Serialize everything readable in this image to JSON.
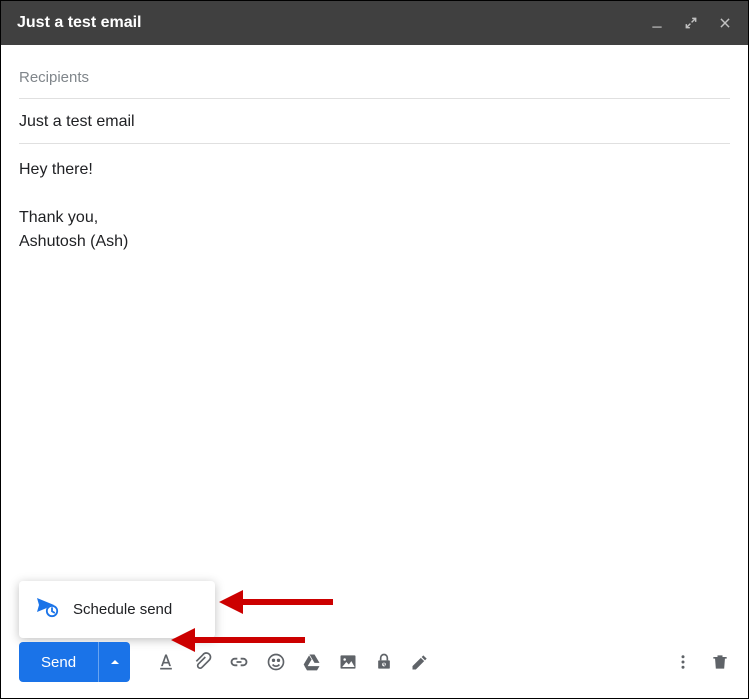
{
  "titlebar": {
    "title": "Just a test email"
  },
  "fields": {
    "recipients_placeholder": "Recipients",
    "subject": "Just a test email"
  },
  "body": {
    "greeting": "Hey there!",
    "signoff": "Thank you,",
    "signature": "Ashutosh (Ash)"
  },
  "actions": {
    "send_label": "Send",
    "schedule_send_label": "Schedule send"
  },
  "icons": {
    "minimize": "minimize",
    "expand": "expand",
    "close": "close",
    "formatting": "formatting",
    "attach": "attach",
    "link": "link",
    "emoji": "emoji",
    "drive": "drive",
    "photo": "photo",
    "confidential": "confidential",
    "pen": "pen",
    "more": "more",
    "delete": "delete",
    "schedule": "schedule-send",
    "caret": "caret-up"
  }
}
